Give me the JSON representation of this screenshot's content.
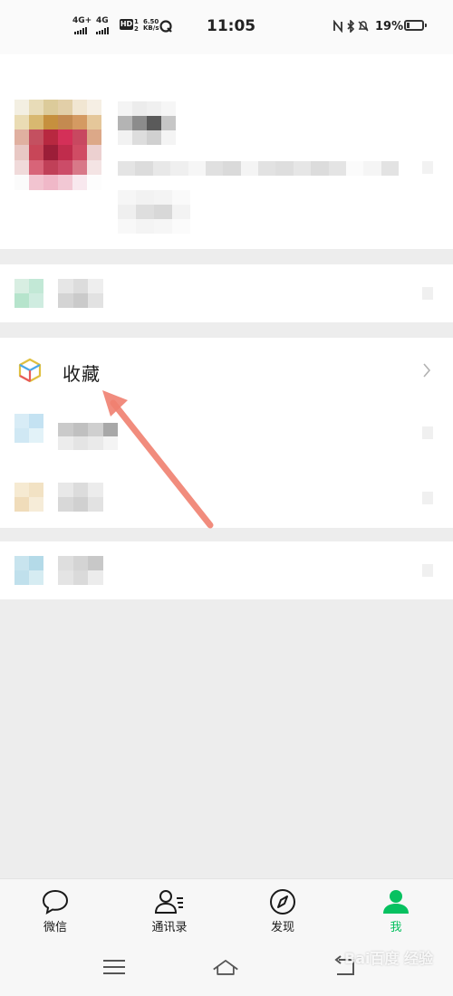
{
  "status_bar": {
    "network_1": "4G+",
    "network_2": "4G",
    "hd_label": "HD",
    "hd_sim_1": "1",
    "hd_sim_2": "2",
    "speed_value": "6.50",
    "speed_unit": "KB/s",
    "time": "11:05",
    "battery_percent": "19%",
    "battery_level": 0.19
  },
  "menu": {
    "favorites_label": "收藏"
  },
  "tab_bar": {
    "tabs": [
      {
        "label": "微信",
        "icon": "chat-bubble-icon",
        "active": false
      },
      {
        "label": "通讯录",
        "icon": "contacts-icon",
        "active": false
      },
      {
        "label": "发现",
        "icon": "compass-icon",
        "active": false
      },
      {
        "label": "我",
        "icon": "person-icon",
        "active": true
      }
    ],
    "active_color": "#07c160"
  },
  "system_nav": [
    "menu-icon",
    "home-icon",
    "back-icon"
  ],
  "annotation": {
    "arrow_color": "#f08070"
  },
  "watermark": {
    "text": "Bai百度 经验"
  }
}
